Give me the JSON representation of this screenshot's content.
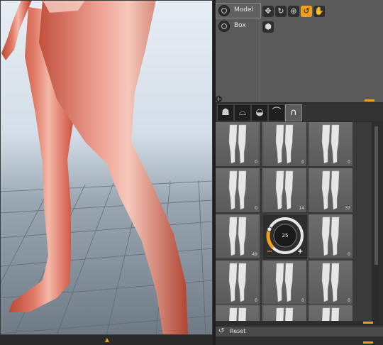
{
  "scene": {
    "items": [
      {
        "label": "Model",
        "selected": true
      },
      {
        "label": "Box",
        "selected": false
      }
    ],
    "tools": [
      {
        "name": "move-icon",
        "glyph": "✥",
        "active": false
      },
      {
        "name": "rotate-icon",
        "glyph": "↻",
        "active": false
      },
      {
        "name": "zoom-icon",
        "glyph": "⊕",
        "active": false
      },
      {
        "name": "undo-icon",
        "glyph": "↺",
        "active": true
      },
      {
        "name": "hand-icon",
        "glyph": "✋",
        "active": false
      }
    ],
    "box_glyph": "⬢"
  },
  "tabs": [
    {
      "name": "tab-head",
      "glyph": "☗",
      "active": false
    },
    {
      "name": "tab-torso",
      "glyph": "⌓",
      "active": false
    },
    {
      "name": "tab-hips",
      "glyph": "◒",
      "active": false
    },
    {
      "name": "tab-arm",
      "glyph": "⌒",
      "active": false
    },
    {
      "name": "tab-legs",
      "glyph": "∩",
      "active": true
    }
  ],
  "grid": {
    "cells": [
      {
        "count": "0"
      },
      {
        "count": "0"
      },
      {
        "count": "0"
      },
      {
        "count": "0"
      },
      {
        "count": "14"
      },
      {
        "count": "37"
      },
      {
        "count": "49"
      },
      {
        "count": ""
      },
      {
        "count": "0"
      },
      {
        "count": "0"
      },
      {
        "count": "0"
      },
      {
        "count": "0"
      },
      {
        "count": ""
      },
      {
        "count": ""
      },
      {
        "count": ""
      }
    ],
    "dial": {
      "value": "25",
      "minus": "−",
      "plus": "+",
      "level": 0.25
    }
  },
  "reset": {
    "label": "Reset",
    "glyph": "↺"
  },
  "viewport": {
    "collapse_glyph": "▲"
  },
  "colors": {
    "accent": "#f0a020",
    "skin": "#d86a58",
    "panel": "#5a5a5a"
  }
}
